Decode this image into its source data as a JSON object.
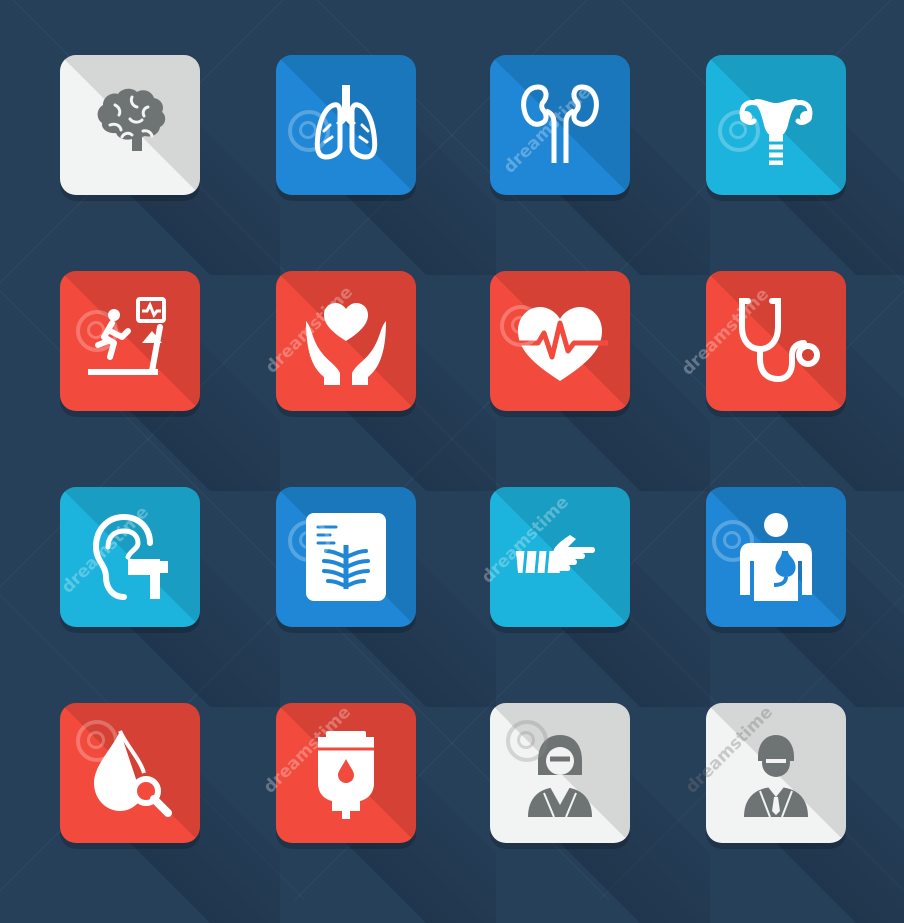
{
  "colors": {
    "background": "#27405a",
    "white_tile": "#f2f3f3",
    "blue_tile": "#1f87d6",
    "cyan_tile": "#1cb3dd",
    "red_tile": "#f24a3c",
    "icon_dark": "#6d7473",
    "icon_light": "#ffffff"
  },
  "watermark": {
    "text": "dreamstime"
  },
  "icons": [
    {
      "name": "brain-icon",
      "tile_color": "white"
    },
    {
      "name": "lungs-icon",
      "tile_color": "blue"
    },
    {
      "name": "kidneys-icon",
      "tile_color": "blue"
    },
    {
      "name": "uterus-icon",
      "tile_color": "cyan"
    },
    {
      "name": "treadmill-stress-test-icon",
      "tile_color": "red"
    },
    {
      "name": "hands-holding-heart-icon",
      "tile_color": "red"
    },
    {
      "name": "heartbeat-heart-icon",
      "tile_color": "red"
    },
    {
      "name": "stethoscope-icon",
      "tile_color": "red"
    },
    {
      "name": "ear-hearing-test-icon",
      "tile_color": "cyan"
    },
    {
      "name": "chest-xray-icon",
      "tile_color": "blue"
    },
    {
      "name": "broken-arm-cast-icon",
      "tile_color": "cyan"
    },
    {
      "name": "gastroenterology-body-icon",
      "tile_color": "blue"
    },
    {
      "name": "blood-drop-search-icon",
      "tile_color": "red"
    },
    {
      "name": "iv-drip-bag-icon",
      "tile_color": "red"
    },
    {
      "name": "female-doctor-icon",
      "tile_color": "white"
    },
    {
      "name": "male-doctor-icon",
      "tile_color": "white"
    }
  ]
}
